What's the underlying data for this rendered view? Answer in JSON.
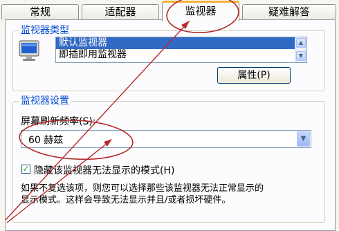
{
  "tabs": [
    {
      "label": "常规"
    },
    {
      "label": "适配器"
    },
    {
      "label": "监视器"
    },
    {
      "label": "疑难解答"
    }
  ],
  "active_tab": "监视器",
  "monitor_type": {
    "title": "监视器类型",
    "list_items": [
      "默认监视器",
      "即插即用监视器"
    ],
    "selected_item": "默认监视器",
    "properties_button": "属性(P)"
  },
  "monitor_settings": {
    "title": "监视器设置",
    "refresh_label": "屏幕刷新频率(S):",
    "refresh_value": "60 赫兹",
    "hide_modes_label": "隐藏该监视器无法显示的模式(H)",
    "hide_modes_checked": true,
    "description_lines": [
      "如果不复选该项，则您可以选择那些该监视器无法正常显示的",
      "显示模式。这样会导致无法显示并且/或者损坏硬件。"
    ]
  },
  "annotation_color": "#b52a2a",
  "icons": [
    "monitor-icon",
    "scroll-up-icon",
    "scroll-down-icon",
    "dropdown-arrow-icon",
    "checkmark-icon"
  ]
}
